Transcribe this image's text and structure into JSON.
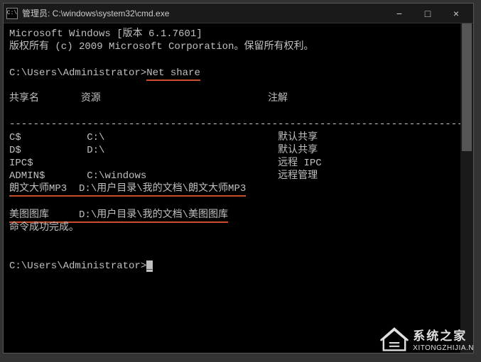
{
  "titlebar": {
    "icon_text": "C:\\",
    "title": "管理员: C:\\windows\\system32\\cmd.exe",
    "minimize": "−",
    "maximize": "□",
    "close": "×"
  },
  "terminal": {
    "header_line1": "Microsoft Windows [版本 6.1.7601]",
    "header_line2": "版权所有 (c) 2009 Microsoft Corporation。保留所有权利。",
    "prompt1_prefix": "C:\\Users\\Administrator>",
    "command1": "Net share",
    "columns": {
      "name": "共享名",
      "resource": "资源",
      "remark": "注解"
    },
    "separator": "------------------------------------------------------------------------------",
    "shares": [
      {
        "name": "C$",
        "resource": "C:\\",
        "remark": "默认共享"
      },
      {
        "name": "D$",
        "resource": "D:\\",
        "remark": "默认共享"
      },
      {
        "name": "IPC$",
        "resource": "",
        "remark": "远程 IPC"
      },
      {
        "name": "ADMIN$",
        "resource": "C:\\windows",
        "remark": "远程管理"
      },
      {
        "name": "朗文大师MP3",
        "resource": "D:\\用户目录\\我的文档\\朗文大师MP3",
        "remark": ""
      },
      {
        "name": "",
        "resource": "",
        "remark": ""
      },
      {
        "name": "美图图库",
        "resource": "D:\\用户目录\\我的文档\\美图图库",
        "remark": ""
      }
    ],
    "success": "命令成功完成。",
    "prompt2": "C:\\Users\\Administrator>",
    "cursor": "_"
  },
  "watermark": {
    "title": "系统之家",
    "url": "XITONGZHIJIA.N"
  }
}
